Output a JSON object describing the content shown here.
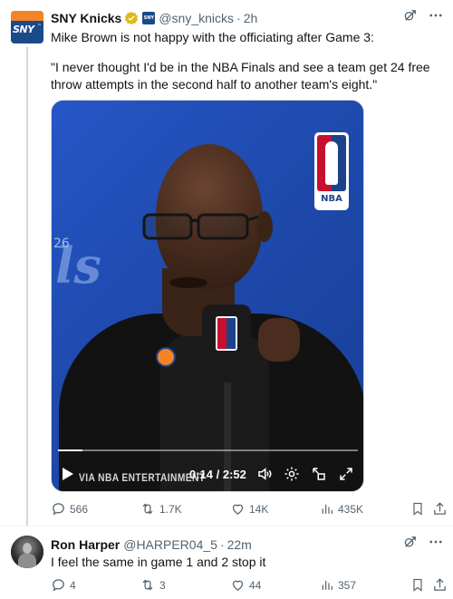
{
  "main_tweet": {
    "author_name": "SNY Knicks",
    "handle": "@sny_knicks",
    "separator": "·",
    "time": "2h",
    "avatar_text": "SNY",
    "affiliate_badge_text": "SNY",
    "text_line1": "Mike Brown is not happy with the officiating after Game 3:",
    "quote": "\"I never thought I'd be in the NBA Finals and see a team get 24 free throw attempts in the second half to another team's eight.\"",
    "video": {
      "watermark": "VIA NBA ENTERTAINMENT",
      "time_display": "0:14 / 2:52",
      "progress_fraction": 0.0814,
      "background_text_left": "ls",
      "background_text_26": "26",
      "logo_text": "NBA"
    },
    "actions": {
      "replies": "566",
      "reposts": "1.7K",
      "likes": "14K",
      "views": "435K"
    }
  },
  "reply_tweet": {
    "author_name": "Ron Harper",
    "handle": "@HARPER04_5",
    "separator": "·",
    "time": "22m",
    "text": "I feel the same in game 1 and 2 stop it",
    "actions": {
      "replies": "4",
      "reposts": "3",
      "likes": "44",
      "views": "357"
    }
  },
  "colors": {
    "accent_orange": "#f58426",
    "knicks_blue": "#1d428a",
    "verified_gold": "#e2b719",
    "muted_text": "#536471"
  }
}
